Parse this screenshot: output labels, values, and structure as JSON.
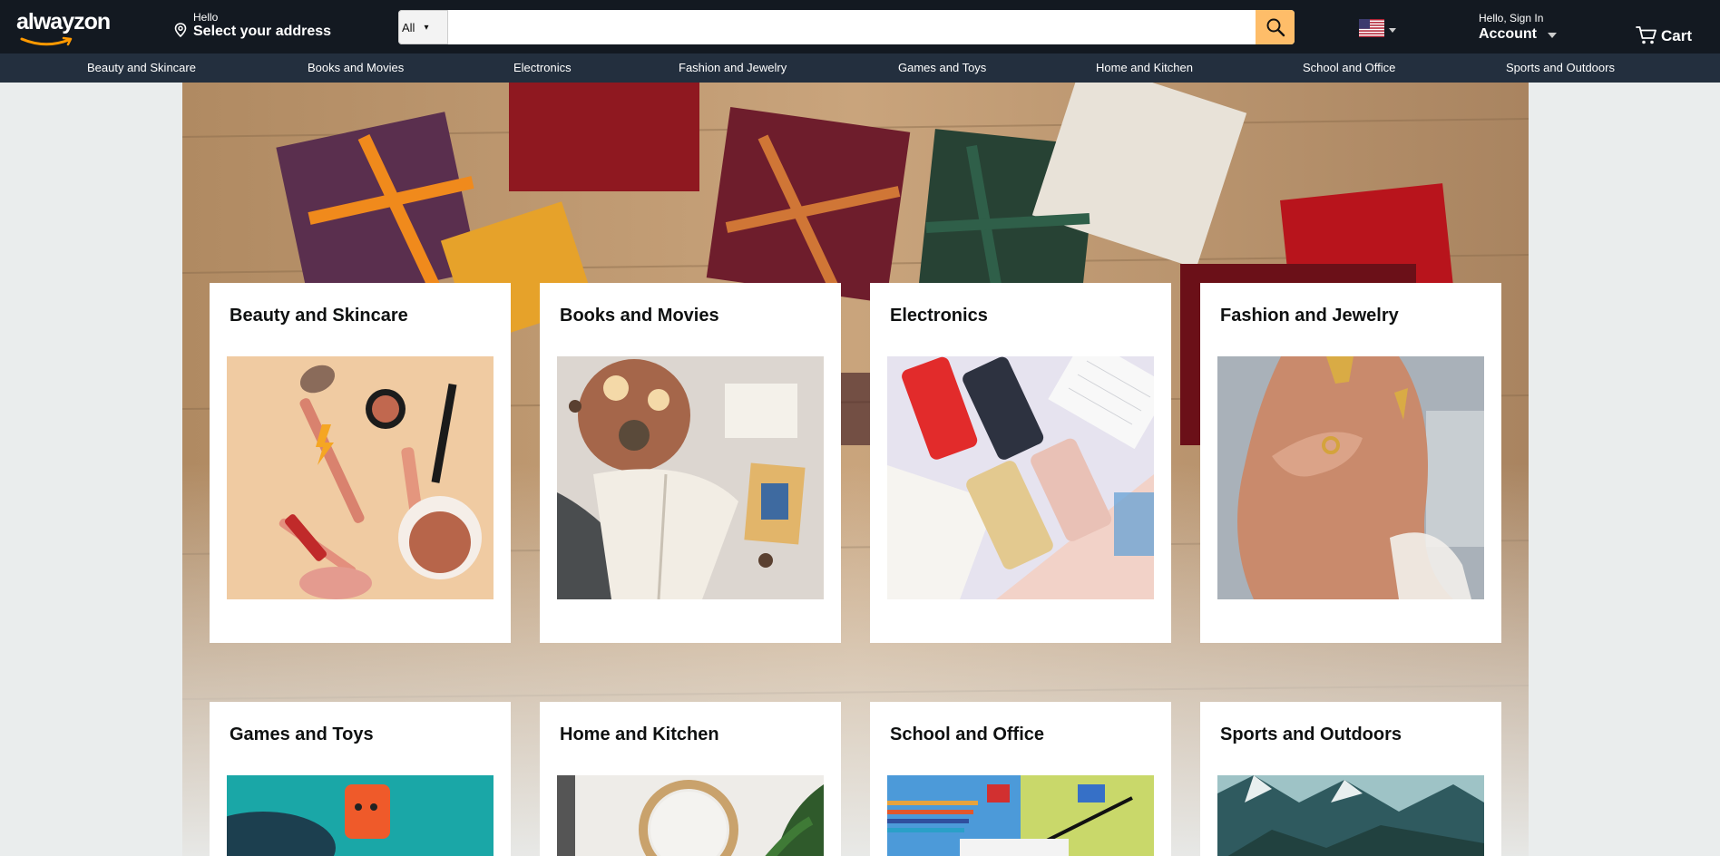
{
  "header": {
    "logo_text": "alwayzon",
    "address_hello": "Hello",
    "address_select": "Select your address",
    "search": {
      "category": "All",
      "placeholder": ""
    },
    "account_hello": "Hello, Sign In",
    "account_label": "Account",
    "cart_label": "Cart"
  },
  "nav": {
    "items": [
      "Beauty and Skincare",
      "Books and Movies",
      "Electronics",
      "Fashion and Jewelry",
      "Games and Toys",
      "Home and Kitchen",
      "School and Office",
      "Sports and Outdoors"
    ]
  },
  "cards": [
    {
      "title": "Beauty and Skincare"
    },
    {
      "title": "Books and Movies"
    },
    {
      "title": "Electronics"
    },
    {
      "title": "Fashion and Jewelry"
    },
    {
      "title": "Games and Toys"
    },
    {
      "title": "Home and Kitchen"
    },
    {
      "title": "School and Office"
    },
    {
      "title": "Sports and Outdoors"
    }
  ],
  "colors": {
    "header_bg": "#131921",
    "nav_bg": "#232f3e",
    "search_button": "#febd69",
    "page_bg": "#eaeded",
    "logo_smile": "#ff9900"
  },
  "icons": {
    "address": "map-pin-icon",
    "search": "magnifier-icon",
    "flag": "us-flag-icon",
    "cart": "shopping-cart-icon"
  }
}
